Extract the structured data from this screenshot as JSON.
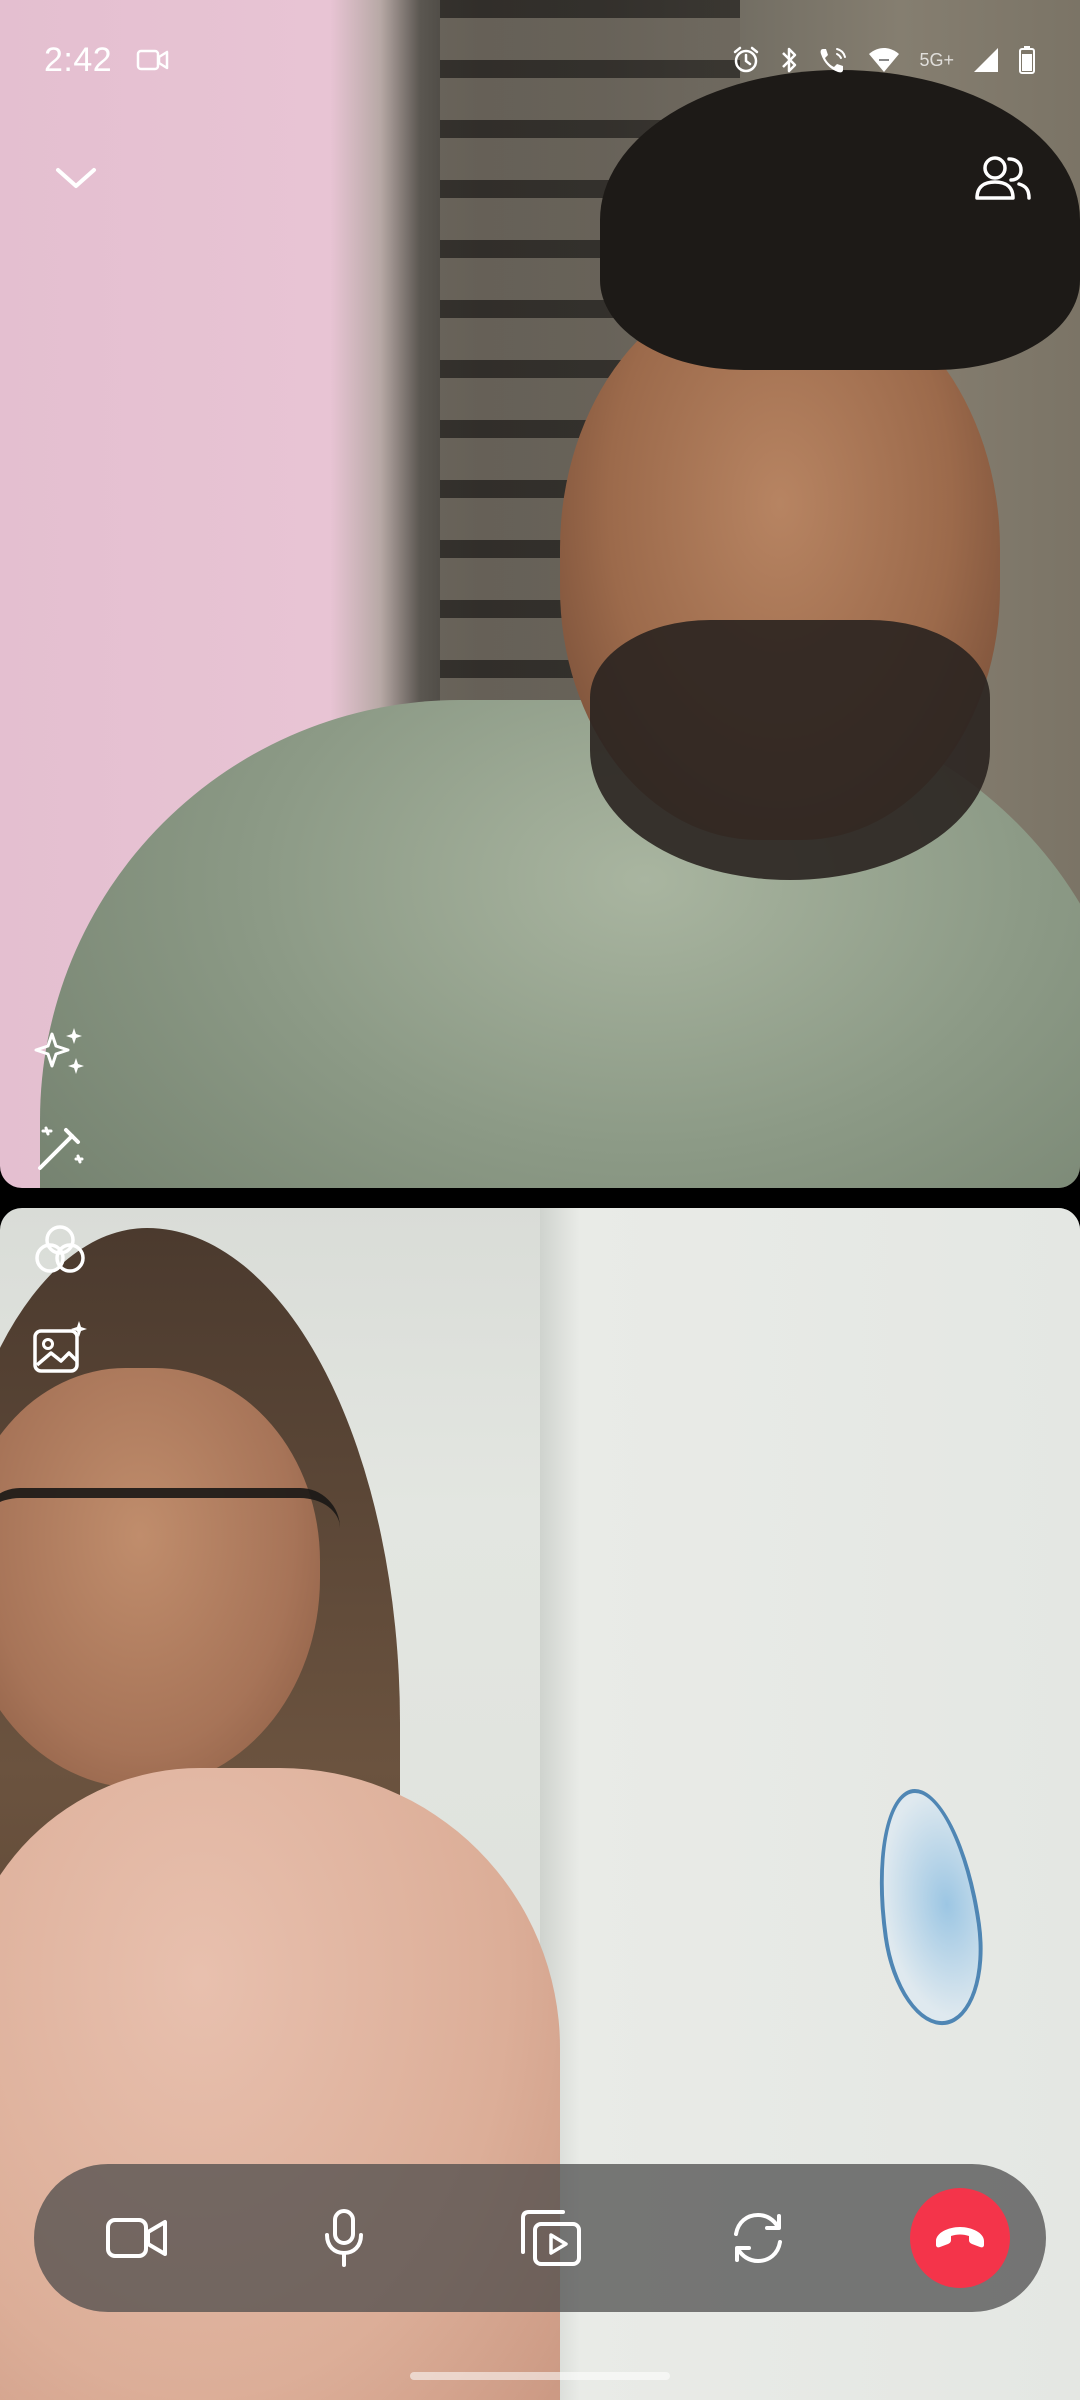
{
  "status_bar": {
    "time": "2:42",
    "network": "5G+",
    "icons": [
      "video-recording-icon",
      "alarm-icon",
      "bluetooth-icon",
      "wifi-calling-icon",
      "wifi-icon",
      "signal-icon",
      "battery-icon"
    ]
  },
  "call": {
    "top_overlay": {
      "minimize_icon": "chevron-down-icon",
      "participants_icon": "people-icon",
      "effects_icon": "sparkles-icon",
      "touch_up_icon": "magic-wand-icon"
    },
    "bottom_overlay": {
      "filters_icon": "filters-icon",
      "background_icon": "image-sparkle-icon"
    },
    "controls": [
      {
        "name": "camera",
        "icon": "video-camera-icon"
      },
      {
        "name": "microphone",
        "icon": "microphone-icon"
      },
      {
        "name": "share-media",
        "icon": "media-share-icon"
      },
      {
        "name": "flip-camera",
        "icon": "flip-camera-icon"
      },
      {
        "name": "end-call",
        "icon": "end-call-icon"
      }
    ],
    "colors": {
      "end_call": "#f4344a",
      "control_bar": "#484848"
    }
  }
}
